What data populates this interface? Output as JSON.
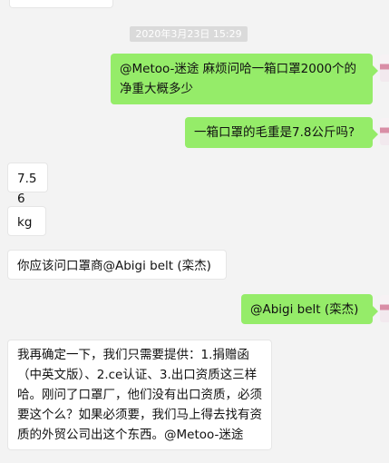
{
  "timestamp": "2020年3月23日 15:29",
  "messages": [
    {
      "side": "out",
      "text": "@Metoo-迷途 麻烦问哈一箱口罩2000个的净重大概多少"
    },
    {
      "side": "out",
      "text": "一箱口罩的毛重是7.8公斤吗?"
    },
    {
      "side": "in",
      "text": "7.56"
    },
    {
      "side": "in",
      "text": "kg"
    },
    {
      "side": "in",
      "text": "你应该问口罩商@Abigi belt (栾杰)"
    },
    {
      "side": "out",
      "text": "@Abigi belt (栾杰)"
    },
    {
      "side": "in",
      "text": "我再确定一下，我们只需要提供：1.捐赠函（中英文版）、2.ce认证、3.出口资质这三样哈。刚问了口罩厂，他们没有出口资质，必须要这个么？如果必须要，我们马上得去找有资质的外贸公司出这个东西。@Metoo-迷途"
    }
  ],
  "colors": {
    "background": "#f3f3f3",
    "outgoing_bubble": "#95ec69",
    "incoming_bubble": "#ffffff",
    "timestamp_bg": "#dadada"
  },
  "icons": {
    "avatar": "user-avatar-image"
  }
}
